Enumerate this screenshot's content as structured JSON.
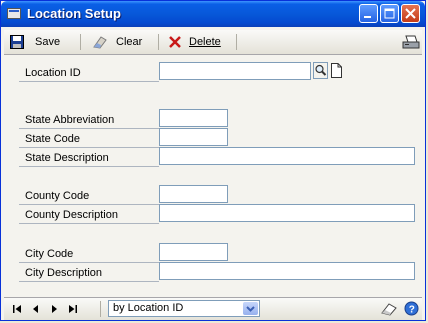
{
  "window": {
    "title": "Location Setup",
    "title_icon": "window-icon",
    "controls": [
      "minimize-icon",
      "maximize-icon",
      "close-icon"
    ]
  },
  "toolbar": {
    "save_label": "Save",
    "clear_label": "Clear",
    "delete_label": "Delete",
    "print_icon": "printer-icon"
  },
  "form": {
    "location_id_label": "Location ID",
    "state_abbreviation_label": "State Abbreviation",
    "state_code_label": "State Code",
    "state_description_label": "State Description",
    "county_code_label": "County Code",
    "county_description_label": "County Description",
    "city_code_label": "City Code",
    "city_description_label": "City Description",
    "values": {
      "location_id": "",
      "state_abbreviation": "",
      "state_code": "",
      "state_description": "",
      "county_code": "",
      "county_description": "",
      "city_code": "",
      "city_description": ""
    }
  },
  "bottom": {
    "sort_value": "by Location ID",
    "nav_icons": [
      "first-record-icon",
      "previous-record-icon",
      "next-record-icon",
      "last-record-icon"
    ]
  },
  "colors": {
    "titlebar": "#0758d9",
    "window_bg": "#f4f3ee",
    "field_border": "#7f9db9"
  }
}
